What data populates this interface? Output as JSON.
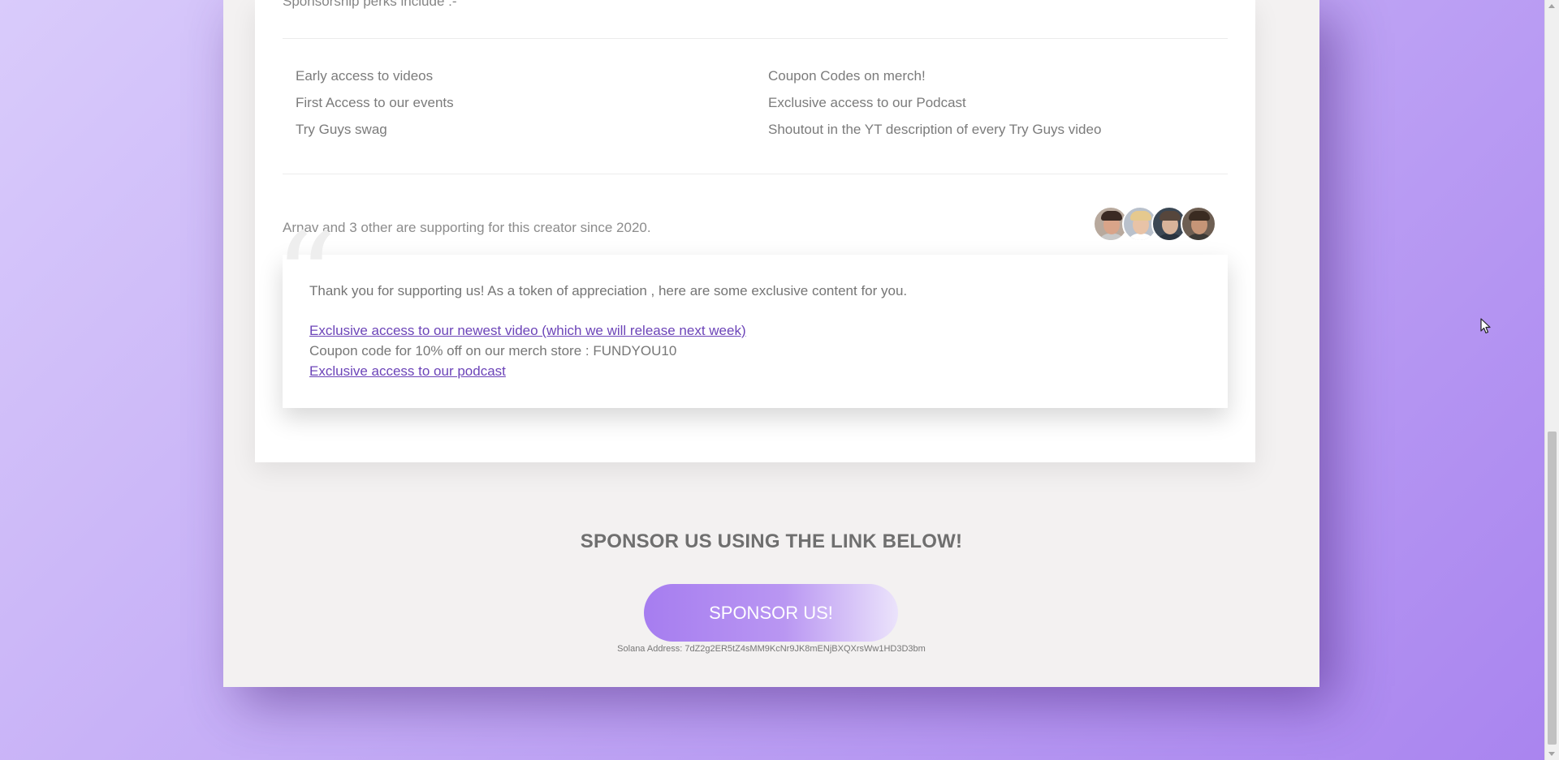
{
  "perks": {
    "intro": "Sponsorship perks include :-",
    "left": [
      "Early access to videos",
      "First Access to our events",
      "Try Guys swag"
    ],
    "right": [
      "Coupon Codes on merch!",
      "Exclusive access to our Podcast",
      "Shoutout in the YT description of every Try Guys video"
    ]
  },
  "supporters": {
    "text": "Arnav and 3 other are supporting for this creator since 2020.",
    "avatars": [
      {
        "name": "supporter-avatar-1",
        "skin": "#d9a489",
        "hair": "#3a2a24",
        "shirt": "#c9c9c9",
        "bg": "#b8a99d"
      },
      {
        "name": "supporter-avatar-2",
        "skin": "#e8c3a7",
        "hair": "#e5c98e",
        "shirt": "#ffffff",
        "bg": "#b9c1cc"
      },
      {
        "name": "supporter-avatar-3",
        "skin": "#d8b39a",
        "hair": "#56463c",
        "shirt": "#2a3440",
        "bg": "#3b4754"
      },
      {
        "name": "supporter-avatar-4",
        "skin": "#c69577",
        "hair": "#3a2b21",
        "shirt": "#3d3a36",
        "bg": "#6d5e52"
      }
    ]
  },
  "exclusive": {
    "quote_mark": "“",
    "thanks": "Thank you for supporting us! As a token of appreciation , here are some exclusive content for you.",
    "video_link": "Exclusive access to our newest video (which we will release next week)",
    "coupon": "Coupon code for 10% off on our merch store : FUNDYOU10",
    "podcast_link": "Exclusive access to our podcast"
  },
  "cta": {
    "heading": "SPONSOR US USING THE LINK BELOW!",
    "button": "SPONSOR US!",
    "solana_address": "Solana Address: 7dZ2g2ER5tZ4sMM9KcNr9JK8mENjBXQXrsWw1HD3D3bm"
  },
  "colors": {
    "accent": "#a67df0",
    "link": "#6c44b8",
    "background_gradient": [
      "#d9cbfb",
      "#a984ef"
    ]
  }
}
